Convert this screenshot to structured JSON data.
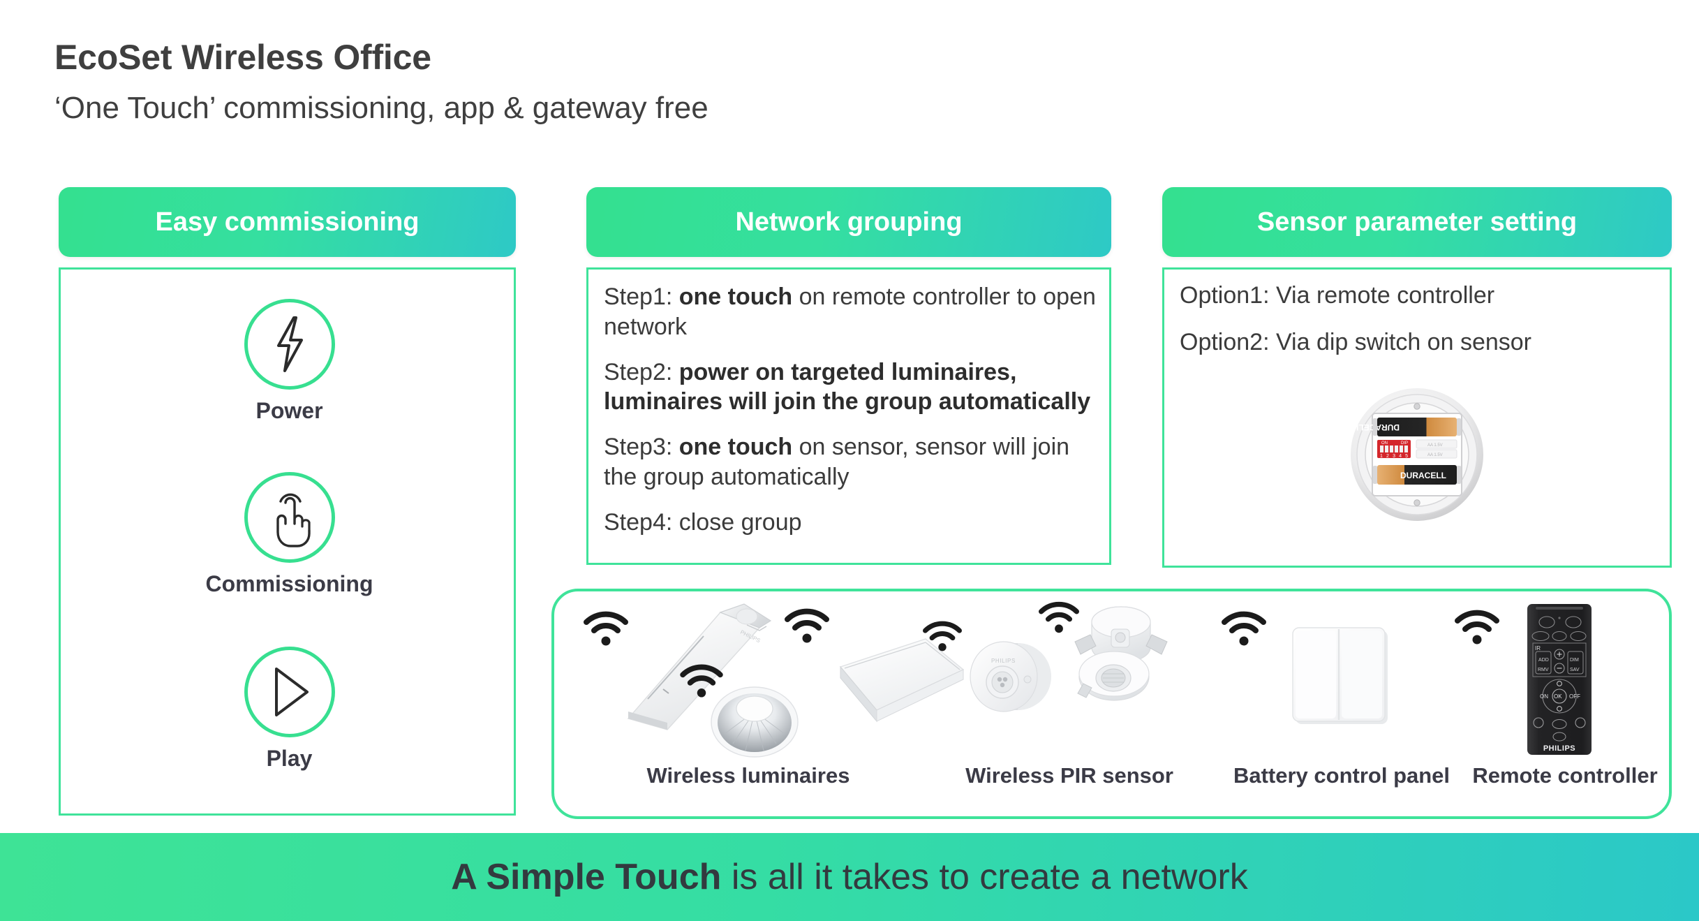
{
  "header": {
    "title": "EcoSet Wireless Office",
    "subtitle": "‘One Touch’ commissioning, app & gateway free"
  },
  "columns": {
    "easy": {
      "header": "Easy commissioning",
      "items": [
        {
          "label": "Power",
          "icon": "lightning-bolt-icon"
        },
        {
          "label": "Commissioning",
          "icon": "hand-tap-icon"
        },
        {
          "label": "Play",
          "icon": "play-triangle-icon"
        }
      ]
    },
    "network": {
      "header": "Network grouping",
      "steps": [
        {
          "prefix": "Step1: ",
          "bold": "one touch",
          "suffix": " on remote controller to open network"
        },
        {
          "prefix": "Step2: ",
          "bold": "power on targeted luminaires, luminaires will join the group automatically",
          "suffix": ""
        },
        {
          "prefix": "Step3: ",
          "bold": "one touch",
          "suffix": " on sensor, sensor will join the group automatically"
        },
        {
          "prefix": "Step4: close group",
          "bold": "",
          "suffix": ""
        }
      ]
    },
    "sensor": {
      "header": "Sensor parameter setting",
      "options": [
        "Option1: Via remote controller",
        "Option2: Via dip switch on sensor"
      ],
      "photo": {
        "name": "sensor-battery-compartment",
        "battery_brand": "DURACELL",
        "dip_switch": {
          "on_label": "ON",
          "dip_label": "DIP",
          "positions": "1 2 3 4 5 6"
        }
      }
    }
  },
  "devices": [
    {
      "label": "Wireless luminaires",
      "icon": "wifi-icon"
    },
    {
      "label": "Wireless PIR sensor",
      "icon": "wifi-icon"
    },
    {
      "label": "Battery control panel",
      "icon": "wifi-icon"
    },
    {
      "label": "Remote controller",
      "icon": "wifi-icon"
    }
  ],
  "remote": {
    "brand": "PHILIPS"
  },
  "banner": {
    "bold": "A Simple Touch",
    "rest": " is all it takes to create a network"
  },
  "colors": {
    "accent_green": "#3fe39a",
    "accent_teal": "#2bc8c8",
    "text_dark": "#3b3b46",
    "header_text": "#ffffff"
  }
}
